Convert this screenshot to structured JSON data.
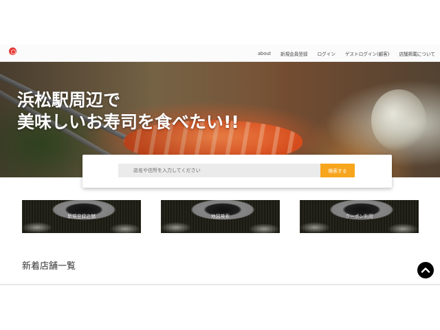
{
  "header": {
    "logo_icon": "sushi-logo-icon",
    "nav": [
      {
        "label": "about"
      },
      {
        "label": "新規会員登録"
      },
      {
        "label": "ログイン"
      },
      {
        "label": "ゲストログイン(顧客)"
      },
      {
        "label": "店舗掲載について"
      }
    ]
  },
  "hero": {
    "title_line1": "浜松駅周辺で",
    "title_line2": "美味しいお寿司を食べたい!!"
  },
  "search": {
    "placeholder": "店名や住所を入力してください",
    "button_label": "検索する",
    "button_color": "#f7a51c"
  },
  "cards": [
    {
      "label": "新規登録店舗"
    },
    {
      "label": "地図検索"
    },
    {
      "label": "クーポン利用"
    }
  ],
  "section": {
    "title": "新着店舗一覧"
  },
  "scroll_top": {
    "icon": "chevron-up-icon"
  }
}
